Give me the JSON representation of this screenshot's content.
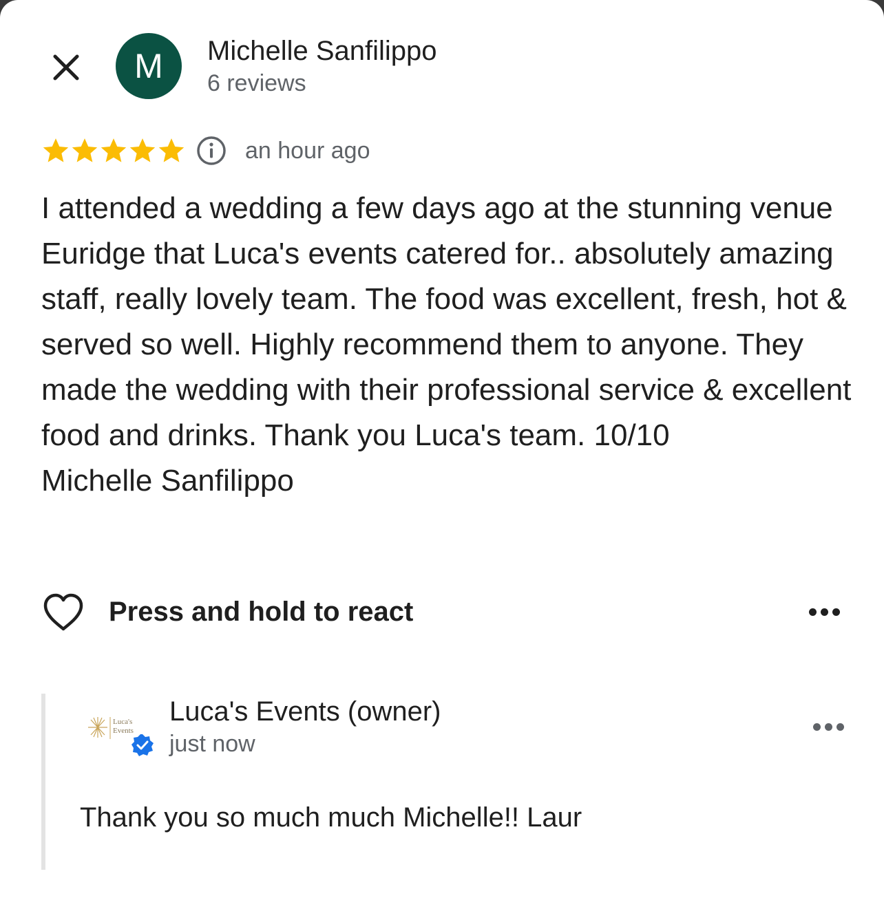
{
  "reviewer": {
    "avatar_initial": "M",
    "avatar_color": "#0b5243",
    "name": "Michelle Sanfilippo",
    "review_count": "6 reviews"
  },
  "review": {
    "rating": 5,
    "max_rating": 5,
    "star_color": "#fbbc04",
    "time": "an hour ago",
    "text": "I attended a wedding a few days ago at the stunning venue Euridge that Luca's events catered for.. absolutely amazing staff, really lovely team. The food was excellent, fresh, hot & served so well. Highly recommend them to anyone. They made the wedding with their professional service & excellent food and drinks. Thank you Luca's team. 10/10\nMichelle Sanfilippo"
  },
  "actions": {
    "react_label": "Press and hold to react",
    "heart_icon": "heart-outline-icon",
    "more_icon": "more-horizontal-icon"
  },
  "owner_reply": {
    "name": "Luca's Events (owner)",
    "time": "just now",
    "text": "Thank you so much much Michelle!! Laur",
    "logo_text_line1": "Luca's",
    "logo_text_line2": "Events",
    "verified_color": "#1a73e8"
  }
}
